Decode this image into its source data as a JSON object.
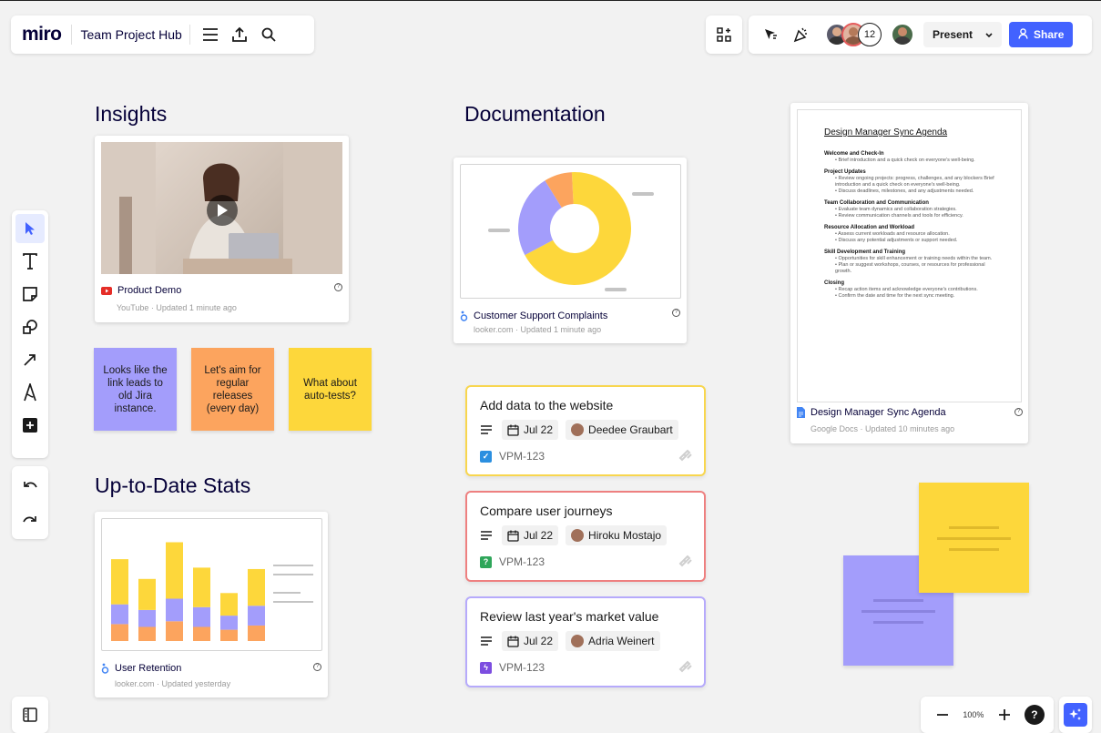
{
  "header": {
    "logo": "miro",
    "board_title": "Team Project Hub",
    "collaborator_count": "12",
    "present_label": "Present",
    "share_label": "Share"
  },
  "sections": {
    "insights": "Insights",
    "documentation": "Documentation",
    "stats": "Up-to-Date Stats"
  },
  "cards": {
    "video": {
      "title": "Product Demo",
      "sub": "YouTube · Updated 1 minute ago"
    },
    "donut": {
      "title": "Customer Support Complaints",
      "sub": "looker.com · Updated 1 minute ago"
    },
    "doc": {
      "title": "Design Manager Sync Agenda",
      "sub": "Google Docs · Updated 10 minutes ago",
      "heading": "Design Manager Sync Agenda",
      "sections": [
        {
          "h": "Welcome and Check-In",
          "items": [
            "Brief introduction and a quick check on everyone's well-being."
          ]
        },
        {
          "h": "Project Updates",
          "items": [
            "Review ongoing projects: progress, challenges, and any blockers Brief introduction and a quick check on everyone's well-being.",
            "Discuss deadlines, milestones, and any adjustments needed."
          ]
        },
        {
          "h": "Team Collaboration and Communication",
          "items": [
            "Evaluate team dynamics and collaboration strategies.",
            "Review communication channels and tools for efficiency."
          ]
        },
        {
          "h": "Resource Allocation and Workload",
          "items": [
            "Assess current workloads and resource allocation.",
            "Discuss any potential adjustments or support needed."
          ]
        },
        {
          "h": "Skill Development and Training",
          "items": [
            "Opportunities for skill enhancement or training needs within the team.",
            "Plan or suggest workshops, courses, or resources for professional growth."
          ]
        },
        {
          "h": "Closing",
          "items": [
            "Recap action items and acknowledge everyone's contributions.",
            "Confirm the date and time for the next sync meeting."
          ]
        }
      ]
    },
    "bars": {
      "title": "User Retention",
      "sub": "looker.com · Updated yesterday"
    }
  },
  "stickies": [
    {
      "text": "Looks like the link leads to old Jira instance.",
      "color": "#a39dfb"
    },
    {
      "text": "Let's aim for regular releases (every day)",
      "color": "#fca45e"
    },
    {
      "text": "What about auto-tests?",
      "color": "#fdd73b"
    }
  ],
  "tasks": [
    {
      "title": "Add data to the website",
      "date": "Jul 22",
      "assignee": "Deedee Graubart",
      "id": "VPM-123",
      "border": "#f8d64e",
      "badge": "#2b8fe0",
      "badge_glyph": "✓"
    },
    {
      "title": "Compare user journeys",
      "date": "Jul 22",
      "assignee": "Hiroku Mostajo",
      "id": "VPM-123",
      "border": "#ee8080",
      "badge": "#2fa65a",
      "badge_glyph": "?"
    },
    {
      "title": "Review last year's market value",
      "date": "Jul 22",
      "assignee": "Adria Weinert",
      "id": "VPM-123",
      "border": "#b6aafb",
      "badge": "#7c4de0",
      "badge_glyph": "ϟ"
    }
  ],
  "zoom": {
    "level": "100%"
  },
  "colors": {
    "accent": "#4262ff",
    "yellow": "#fdd73b",
    "purple": "#a39dfb",
    "orange": "#fca45e"
  },
  "donut_data": {
    "values": [
      68,
      24,
      8
    ],
    "colors": [
      "#fdd73b",
      "#a39dfb",
      "#fca45e"
    ]
  },
  "bar_data": {
    "bars": [
      {
        "orange": 12,
        "purple": 14,
        "yellow": 32
      },
      {
        "orange": 10,
        "purple": 12,
        "yellow": 22
      },
      {
        "orange": 14,
        "purple": 16,
        "yellow": 40
      },
      {
        "orange": 10,
        "purple": 14,
        "yellow": 28
      },
      {
        "orange": 8,
        "purple": 10,
        "yellow": 16
      },
      {
        "orange": 11,
        "purple": 14,
        "yellow": 26
      }
    ]
  }
}
